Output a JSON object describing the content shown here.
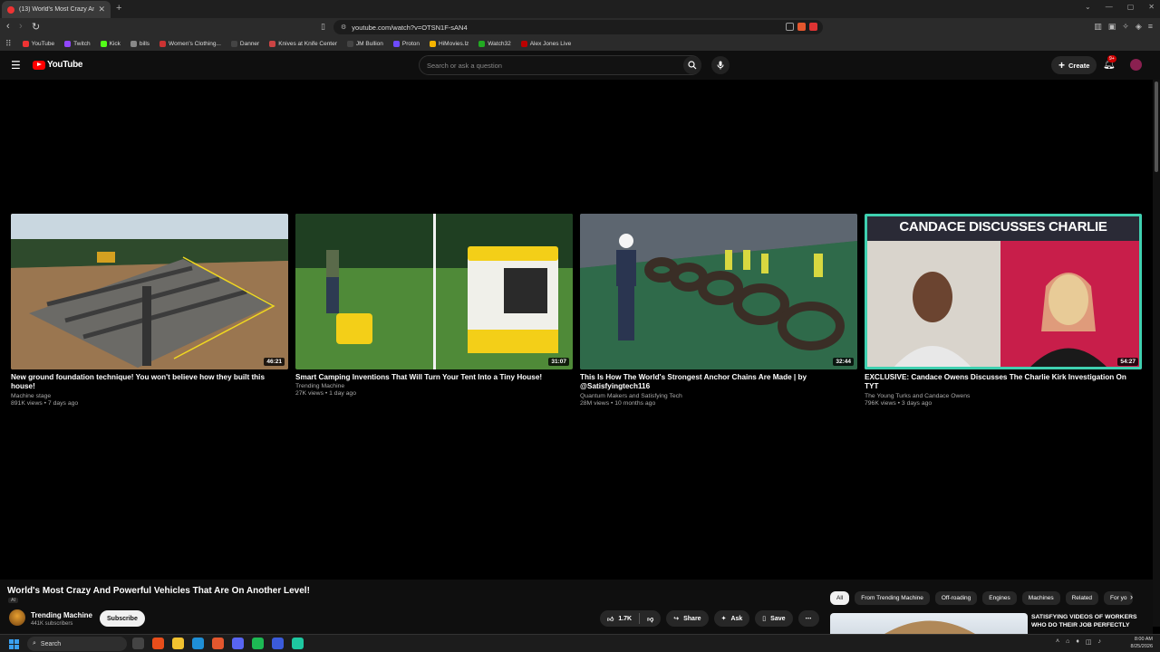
{
  "browser": {
    "tab_title": "(13) World's Most Crazy And Po...",
    "tab_close": "✕",
    "new_tab": "+",
    "url": "youtube.com/watch?v=OTSN1F-sAN4",
    "win_min": "—",
    "win_max": "▢",
    "win_close": "✕",
    "bookmarks": [
      {
        "label": "YouTube",
        "color": "#e33"
      },
      {
        "label": "Twitch",
        "color": "#9146ff"
      },
      {
        "label": "Kick",
        "color": "#53fc18"
      },
      {
        "label": "bills",
        "color": "#888"
      },
      {
        "label": "Women's Clothing...",
        "color": "#c33"
      },
      {
        "label": "Danner",
        "color": "#444"
      },
      {
        "label": "Knives at Knife Center",
        "color": "#c44"
      },
      {
        "label": "JM Bullion",
        "color": "#444"
      },
      {
        "label": "Proton",
        "color": "#6d4aff"
      },
      {
        "label": "HiMovies.lz",
        "color": "#f5b400"
      },
      {
        "label": "Watch32",
        "color": "#2a2"
      },
      {
        "label": "Alex Jones Live",
        "color": "#b00"
      }
    ]
  },
  "masthead": {
    "logo": "YouTube",
    "search_placeholder": "Search or ask a question",
    "create_label": "Create",
    "notif_count": "9+"
  },
  "endscreen": [
    {
      "title": "New ground foundation technique! You won't believe how they built this house!",
      "channel": "Machine stage",
      "meta": "891K views • 7 days ago",
      "duration": "46:21"
    },
    {
      "title": "Smart Camping Inventions That Will Turn Your Tent Into a Tiny House!",
      "channel": "Trending Machine",
      "meta": "27K views • 1 day ago",
      "duration": "31:07"
    },
    {
      "title": "This Is How The World's Strongest Anchor Chains Are Made | by @Satisfyingtech116",
      "channel": "Quantum Makers and Satisfying Tech",
      "meta": "28M views • 10 months ago",
      "duration": "32:44"
    },
    {
      "title": "EXCLUSIVE: Candace Owens Discusses The Charlie Kirk Investigation On TYT",
      "channel": "The Young Turks and Candace Owens",
      "meta": "796K views • 3 days ago",
      "duration": "54:27",
      "thumb_caption": "CANDACE DISCUSSES CHARLIE"
    }
  ],
  "video": {
    "title": "World's Most Crazy And Powerful Vehicles That Are On Another Level!",
    "tag": "AI",
    "channel": "Trending Machine",
    "subscribers": "441K subscribers",
    "subscribe_label": "Subscribe",
    "likes": "1.7K",
    "share_label": "Share",
    "ask_label": "Ask",
    "save_label": "Save",
    "more": "⋯"
  },
  "chips": [
    "All",
    "From Trending Machine",
    "Off-roading",
    "Engines",
    "Machines",
    "Related",
    "For yo"
  ],
  "recommended": {
    "title": "SATISFYING VIDEOS OF WORKERS WHO DO THEIR JOB PERFECTLY"
  },
  "taskbar": {
    "search_label": "Search",
    "time": "8:00 AM",
    "date": "8/25/2026"
  }
}
